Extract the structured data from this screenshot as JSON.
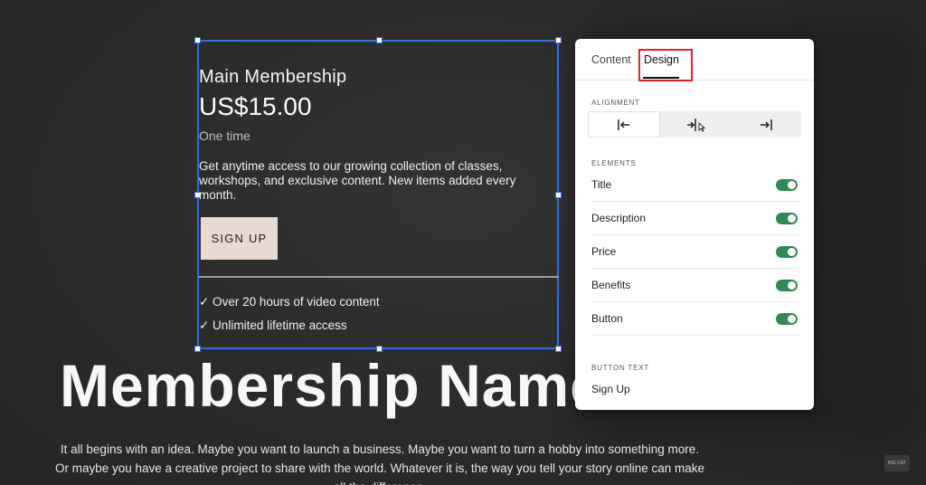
{
  "pricing": {
    "name": "Main Membership",
    "price": "US$15.00",
    "period": "One time",
    "description": "Get anytime access to our growing collection of classes, workshops, and exclusive content. New items added every month.",
    "button_label": "SIGN UP",
    "button_color": "#e9d9d2",
    "benefits": [
      "✓ Over 20 hours of video content",
      "✓ Unlimited lifetime access"
    ]
  },
  "hero": {
    "title": "Membership Name",
    "text": "It all begins with an idea. Maybe you want to launch a business. Maybe you want to turn a hobby into something more. Or maybe you have a creative project to share with the world. Whatever it is, the way you tell your story online can make all the difference."
  },
  "panel": {
    "tabs": [
      {
        "label": "Content",
        "active": false
      },
      {
        "label": "Design",
        "active": true
      }
    ],
    "alignment_label": "ALIGNMENT",
    "alignment_options": [
      "align-left-icon",
      "align-center-icon",
      "align-right-icon"
    ],
    "alignment_selected": "align-left-icon",
    "elements_label": "ELEMENTS",
    "elements": [
      {
        "label": "Title",
        "on": true
      },
      {
        "label": "Description",
        "on": true
      },
      {
        "label": "Price",
        "on": true
      },
      {
        "label": "Benefits",
        "on": true
      },
      {
        "label": "Button",
        "on": true
      }
    ],
    "button_text_label": "BUTTON TEXT",
    "button_text_value": "Sign Up",
    "toggle_color": "#2e8b57",
    "highlight_color": "#e0232a"
  },
  "selection_color": "#2f6fe8",
  "corner_logo": "BIG CAT"
}
